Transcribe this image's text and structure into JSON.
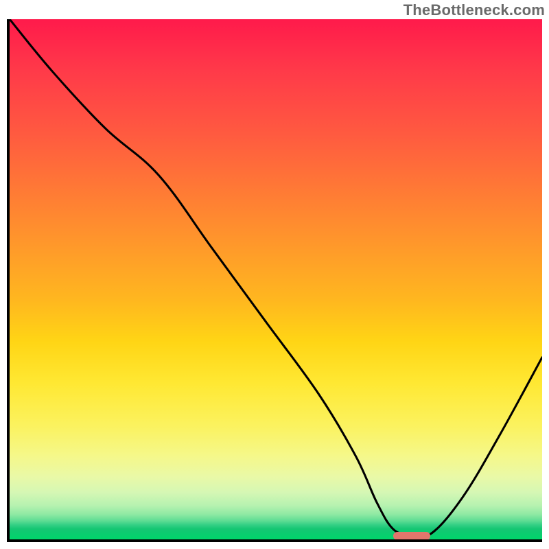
{
  "watermark": "TheBottleneck.com",
  "chart_data": {
    "type": "line",
    "title": "",
    "xlabel": "",
    "ylabel": "",
    "xlim": [
      0,
      100
    ],
    "ylim": [
      0,
      100
    ],
    "grid": false,
    "legend": false,
    "series": [
      {
        "name": "curve",
        "color": "#000000",
        "x": [
          0,
          8,
          18,
          28,
          38,
          48,
          58,
          65,
          69,
          72,
          75,
          79,
          85,
          92,
          100
        ],
        "y": [
          100,
          90,
          79,
          70,
          56,
          42,
          28,
          16,
          7,
          2,
          1,
          1,
          8,
          20,
          35
        ]
      }
    ],
    "background_gradient": {
      "type": "vertical",
      "stops": [
        {
          "pos": 0.0,
          "color": "#ff1a4b"
        },
        {
          "pos": 0.45,
          "color": "#ffa028"
        },
        {
          "pos": 0.7,
          "color": "#ffe833"
        },
        {
          "pos": 0.9,
          "color": "#d5f7b4"
        },
        {
          "pos": 1.0,
          "color": "#00d66b"
        }
      ]
    },
    "marker": {
      "x_start": 72,
      "x_end": 79,
      "y": 0.7,
      "color": "#e0766c",
      "shape": "pill"
    }
  }
}
